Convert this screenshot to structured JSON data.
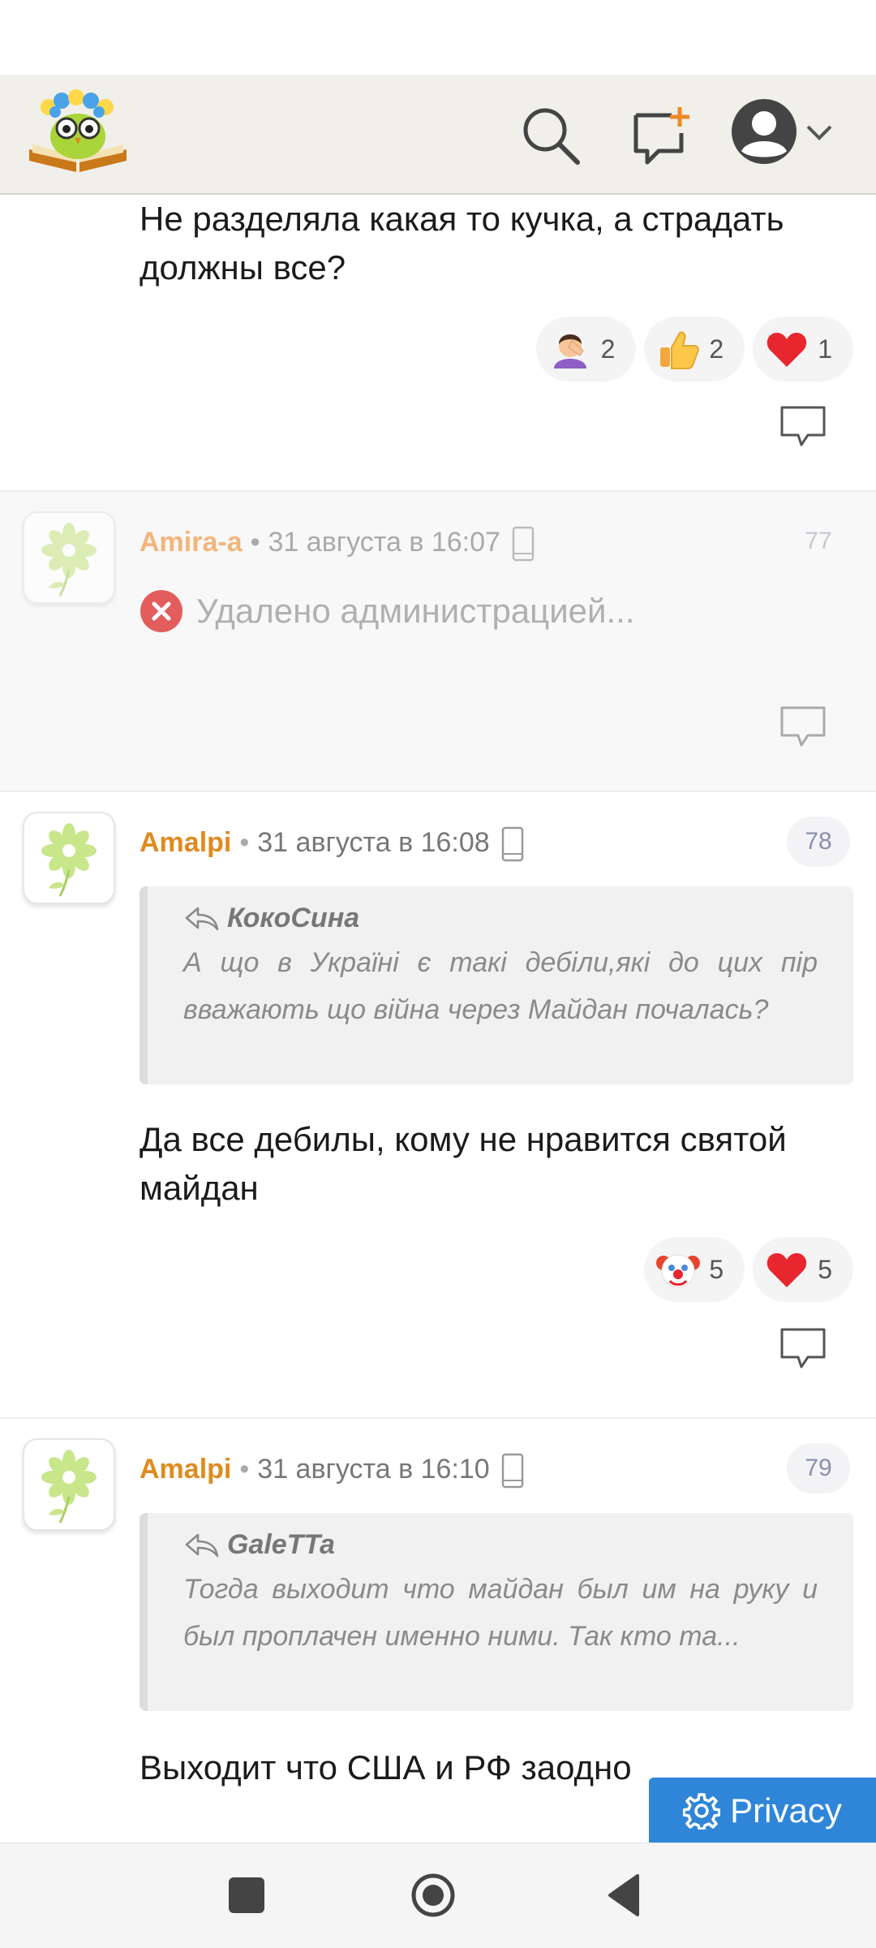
{
  "header": {
    "logo_icon": "owl-book-logo",
    "search_icon": "search-icon",
    "new_post_icon": "new-post-icon",
    "account_icon": "user-avatar-icon"
  },
  "comments": [
    {
      "text": "Не разделяла какая то кучка, а страдать должны все?",
      "reactions": [
        {
          "emoji": "facepalm",
          "count": "2"
        },
        {
          "emoji": "thumbs-up",
          "count": "2"
        },
        {
          "emoji": "heart",
          "count": "1"
        }
      ]
    },
    {
      "author": "Amira-a",
      "date": "31 августа в 16:07",
      "number": "77",
      "deleted_text": "Удалено администрацией..."
    },
    {
      "author": "Amalpi",
      "date": "31 августа в 16:08",
      "number": "78",
      "quote": {
        "author": "КокоСина",
        "text": "А що в Україні є такі дебіли,які до цих пір вважають що війна через Майдан почалась?"
      },
      "text": "Да все дебилы, кому не нравится святой майдан",
      "reactions": [
        {
          "emoji": "clown",
          "count": "5"
        },
        {
          "emoji": "heart",
          "count": "5"
        }
      ]
    },
    {
      "author": "Amalpi",
      "date": "31 августа в 16:10",
      "number": "79",
      "quote": {
        "author": "GaleTTa",
        "text": "Тогда выходит что майдан был им на руку и был проплачен именно ними. Так кто та..."
      },
      "text": "Выходит что США и РФ заодно"
    }
  ],
  "privacy_button": {
    "label": "Privacy"
  },
  "colors": {
    "author": "#e08a1f",
    "privacy": "#2f86d8",
    "header_bg": "#f0efe9"
  }
}
